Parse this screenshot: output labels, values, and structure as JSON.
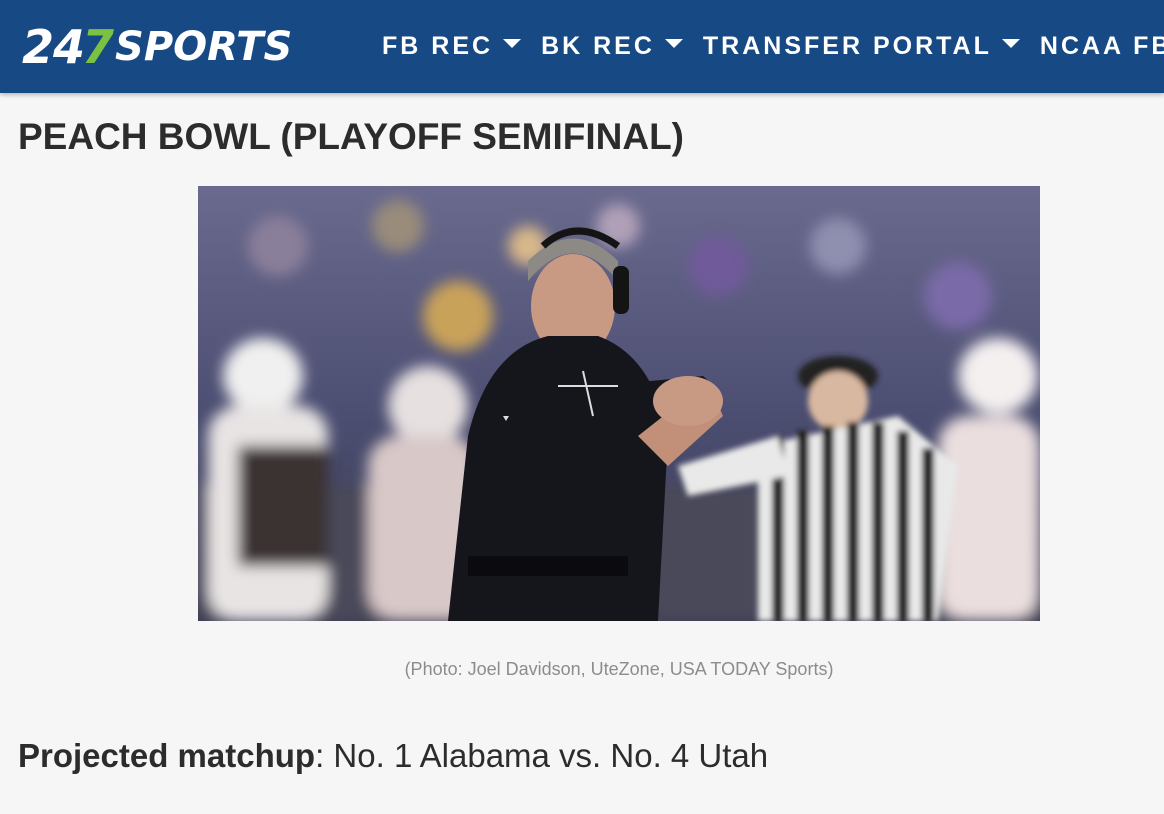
{
  "header": {
    "logo_num": "24",
    "logo_seven": "7",
    "logo_word": "SPORTS",
    "nav": [
      {
        "label": "FB REC"
      },
      {
        "label": "BK REC"
      },
      {
        "label": "TRANSFER PORTAL"
      },
      {
        "label": "NCAA FB"
      }
    ]
  },
  "article": {
    "title": "PEACH BOWL (PLAYOFF SEMIFINAL)",
    "photo_caption": "(Photo: Joel Davidson, UteZone, USA TODAY Sports)",
    "matchup_label": "Projected matchup",
    "matchup_sep": ": ",
    "matchup_value": "No. 1 Alabama vs. No. 4 Utah"
  },
  "colors": {
    "header_bg": "#174a84",
    "logo_accent": "#7bc243",
    "page_bg": "#f6f6f6"
  }
}
